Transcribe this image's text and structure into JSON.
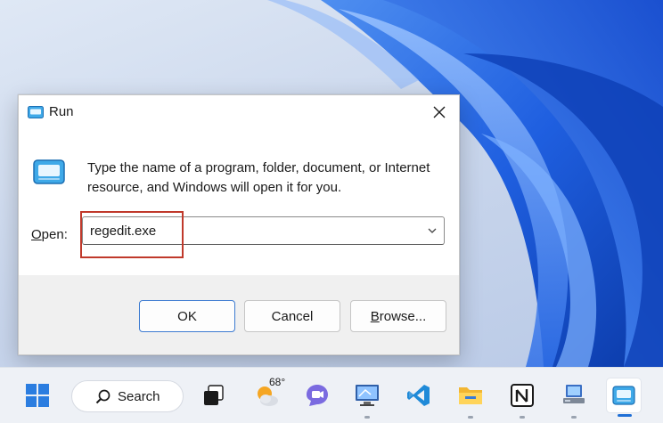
{
  "dialog": {
    "title": "Run",
    "description": "Type the name of a program, folder, document, or Internet resource, and Windows will open it for you.",
    "open_label_underlined": "O",
    "open_label_rest": "pen:",
    "command_value": "regedit.exe",
    "buttons": {
      "ok": "OK",
      "cancel": "Cancel",
      "browse_underlined": "B",
      "browse_rest": "rowse..."
    }
  },
  "taskbar": {
    "search_label": "Search",
    "weather_temp": "68°",
    "items": [
      "windows-start-icon",
      "search-icon",
      "task-view-icon",
      "weather-icon",
      "teams-chat-icon",
      "remote-desktop-icon",
      "vscode-icon",
      "file-explorer-icon",
      "notion-icon",
      "computer-network-icon",
      "run-app-icon"
    ]
  },
  "colors": {
    "accent": "#1f6fd6",
    "highlight": "#c0392b",
    "wallpaper_blue": "#1e5ee8"
  }
}
